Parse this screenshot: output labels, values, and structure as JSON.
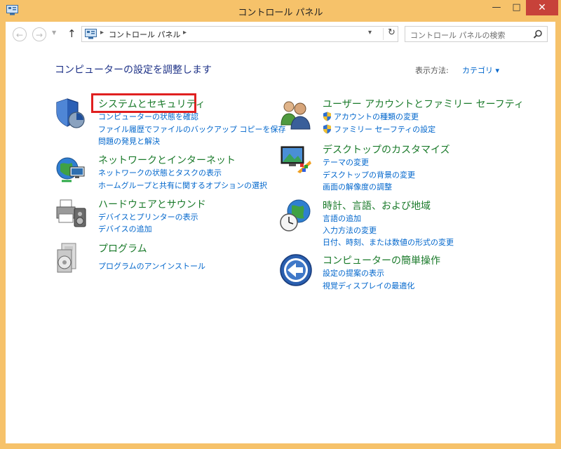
{
  "window": {
    "title": "コントロール パネル",
    "close_glyph": "✕",
    "minimize_glyph": "—",
    "maximize_glyph": "□"
  },
  "nav": {
    "back_glyph": "←",
    "forward_glyph": "→",
    "up_glyph": "↑",
    "dropdown_glyph": "▼"
  },
  "address": {
    "breadcrumb": "コントロール パネル",
    "separator": "▸",
    "dropdown_glyph": "▾",
    "refresh_glyph": "↻"
  },
  "search": {
    "placeholder": "コントロール パネルの検索"
  },
  "page": {
    "heading": "コンピューターの設定を調整します",
    "view_by_label": "表示方法:",
    "view_by_value": "カテゴリ ▾"
  },
  "categories_left": [
    {
      "title": "システムとセキュリティ",
      "icon": "shield-icon",
      "links": [
        "コンピューターの状態を確認",
        "ファイル履歴でファイルのバックアップ コピーを保存",
        "問題の発見と解決"
      ]
    },
    {
      "title": "ネットワークとインターネット",
      "icon": "network-globe-icon",
      "links": [
        "ネットワークの状態とタスクの表示",
        "ホームグループと共有に関するオプションの選択"
      ]
    },
    {
      "title": "ハードウェアとサウンド",
      "icon": "printer-speaker-icon",
      "links": [
        "デバイスとプリンターの表示",
        "デバイスの追加"
      ]
    },
    {
      "title": "プログラム",
      "icon": "programs-icon",
      "links": [
        "プログラムのアンインストール"
      ]
    }
  ],
  "categories_right": [
    {
      "title": "ユーザー アカウントとファミリー セーフティ",
      "icon": "users-icon",
      "links": [
        "アカウントの種類の変更",
        "ファミリー セーフティの設定"
      ]
    },
    {
      "title": "デスクトップのカスタマイズ",
      "icon": "monitor-palette-icon",
      "links": [
        "テーマの変更",
        "デスクトップの背景の変更",
        "画面の解像度の調整"
      ]
    },
    {
      "title": "時計、言語、および地域",
      "icon": "clock-globe-icon",
      "links": [
        "言語の追加",
        "入力方法の変更",
        "日付、時刻、または数値の形式の変更"
      ]
    },
    {
      "title": "コンピューターの簡単操作",
      "icon": "ease-of-access-icon",
      "links": [
        "設定の提案の表示",
        "視覚ディスプレイの最適化"
      ]
    }
  ],
  "colors": {
    "frame": "#f6c26a",
    "heading": "#1e3287",
    "category_title": "#1a7a2a",
    "link": "#0066cc",
    "close_button": "#c7423a",
    "highlight": "#e02020"
  }
}
